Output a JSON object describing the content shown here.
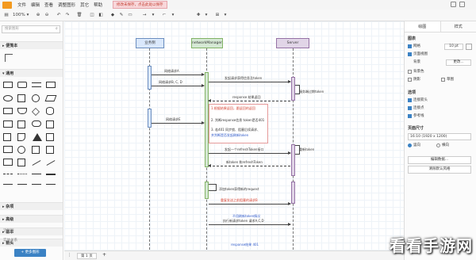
{
  "menubar": {
    "items": [
      "文件",
      "编辑",
      "查看",
      "调整图形",
      "其它",
      "帮助"
    ],
    "warning": "修改未保存，点击此处以保存"
  },
  "toolbar": {
    "zoom": "100%"
  },
  "sidebar": {
    "search_placeholder": "搜索图形",
    "sections": {
      "scratchpad": "便笺本",
      "general": "通用",
      "misc": "杂项",
      "advanced": "高级",
      "basic": "基本",
      "arrows": "箭头"
    },
    "links": [
      "流程图",
      "实体关系"
    ],
    "more_shapes": "+ 更多图形"
  },
  "diagram": {
    "lanes": [
      "业务侧",
      "networkManager",
      "Server"
    ],
    "messages": [
      "网络请求A",
      "网络请求B, C, D",
      "发起请求获得信息及token",
      "服务端过期token",
      "response 结果返回",
      "网络请求E",
      "1.根据结果返回，跟返回的返回",
      "2. 判断response信息 token是否401",
      "3. 若401 同步锁、阻塞后续请求、",
      "并判断是否发起刷新token",
      "发起一个refreshToken接口",
      "重新token",
      "新token 和refreshToken",
      "添加token获得新的request",
      "重复发送之前阻塞的请求B",
      "不用刷新token情况",
      "执行新请求token 请求A,C,D",
      "response结果 401"
    ]
  },
  "bottombar": {
    "page_tab": "第 1 页"
  },
  "rpanel": {
    "tabs": [
      "绘图",
      "样式"
    ],
    "grid_label": "图表",
    "grid": "网格",
    "grid_size": "10 pt",
    "page_view": "页面视图",
    "background": "背景",
    "change_btn": "更改...",
    "bg_color": "背景色",
    "shadow": "阴影",
    "sketch": "草图",
    "options_label": "选项",
    "connection_arrows": "连接箭头",
    "connection_points": "连接点",
    "guides": "参考线",
    "paper_size_label": "页面尺寸",
    "paper_size": "16:10 (1920 x 1200)",
    "portrait": "竖向",
    "landscape": "横向",
    "edit_data": "编辑数据...",
    "clear_style": "清除默认风格"
  },
  "watermark": "看看手游网",
  "colors": {
    "business_fill": "#dae8fc",
    "business_border": "#6c8ebf",
    "network_fill": "#d5e8d4",
    "network_border": "#82b366",
    "server_fill": "#e1d5e7",
    "server_border": "#9673a6",
    "warning_red": "#d23b2b",
    "link_blue": "#2b57c8"
  }
}
